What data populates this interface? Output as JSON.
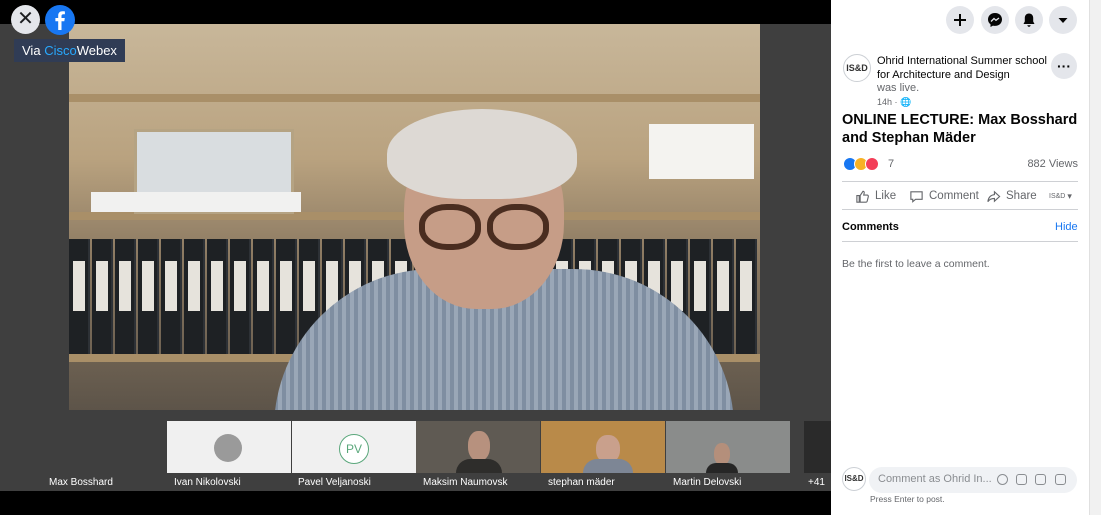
{
  "overlay": {
    "close_icon": "close-icon",
    "facebook_icon": "facebook-icon",
    "via_text": "Via",
    "via_brand_cisco": "Cisco",
    "via_brand_webex": "Webex"
  },
  "video": {
    "main_speaker": "Max Bosshard",
    "participants": [
      {
        "name": "Ivan Nikolovski"
      },
      {
        "name": "Pavel Veljanoski",
        "initials": "PV"
      },
      {
        "name": "Maksim Naumovsk"
      },
      {
        "name": "stephan mäder"
      },
      {
        "name": "Martin Delovski"
      }
    ],
    "more_count": "+41"
  },
  "topbar": {
    "icons": [
      "plus-icon",
      "messenger-icon",
      "notifications-icon",
      "dropdown-icon"
    ]
  },
  "post": {
    "page_avatar": "IS&D",
    "page_name": "Ohrid International Summer school for Architecture and Design",
    "status": "was live.",
    "time": "14h ·",
    "more_label": "···",
    "title": "ONLINE LECTURE: Max Bosshard and Stephan Mäder",
    "reaction_icons": [
      "like-reaction-icon",
      "care-reaction-icon",
      "love-reaction-icon"
    ],
    "reaction_count": "7",
    "views": "882 Views",
    "actions": {
      "like": "Like",
      "comment": "Comment",
      "share": "Share"
    },
    "action_page_avatar": "IS&D",
    "comments_label": "Comments",
    "hide_label": "Hide",
    "empty_comments": "Be the first to leave a comment.",
    "comment_avatar": "IS&D",
    "comment_placeholder": "Comment as Ohrid In...",
    "comment_hint": "Press Enter to post."
  },
  "colors": {
    "facebook_blue": "#1877f2",
    "panel_bg": "#ffffff",
    "video_bg": "#3f3f3f"
  }
}
